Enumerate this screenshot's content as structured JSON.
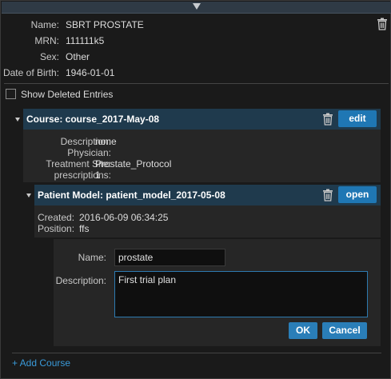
{
  "patient": {
    "name_label": "Name:",
    "name": "SBRT PROSTATE",
    "mrn_label": "MRN:",
    "mrn": "111111k5",
    "sex_label": "Sex:",
    "sex": "Other",
    "dob_label": "Date of Birth:",
    "dob": "1946-01-01"
  },
  "show_deleted_label": "Show Deleted Entries",
  "course": {
    "title": "Course: course_2017-May-08",
    "edit_label": "edit",
    "fields": [
      {
        "label": "Description:",
        "value": "none"
      },
      {
        "label": "Physician:",
        "value": ""
      },
      {
        "label": "Treatment Site:",
        "value": "Prostate_Protocol"
      },
      {
        "label": "prescriptions:",
        "value": "1"
      }
    ]
  },
  "patient_model": {
    "title": "Patient Model: patient_model_2017-05-08",
    "open_label": "open",
    "fields": [
      {
        "label": "Created:",
        "value": "2016-06-09 06:34:25"
      },
      {
        "label": "Position:",
        "value": "ffs"
      }
    ]
  },
  "plan_form": {
    "name_label": "Name:",
    "name_value": "prostate",
    "description_label": "Description:",
    "description_value": "First trial plan",
    "ok_label": "OK",
    "cancel_label": "Cancel"
  },
  "add_course_label": "+ Add Course",
  "colors": {
    "header_bg": "#1f3a4d",
    "button_blue": "#1f77b4",
    "link_blue": "#3a9ad9"
  },
  "icons": [
    "chevron-down-icon",
    "trash-icon",
    "triangle-down-icon"
  ]
}
